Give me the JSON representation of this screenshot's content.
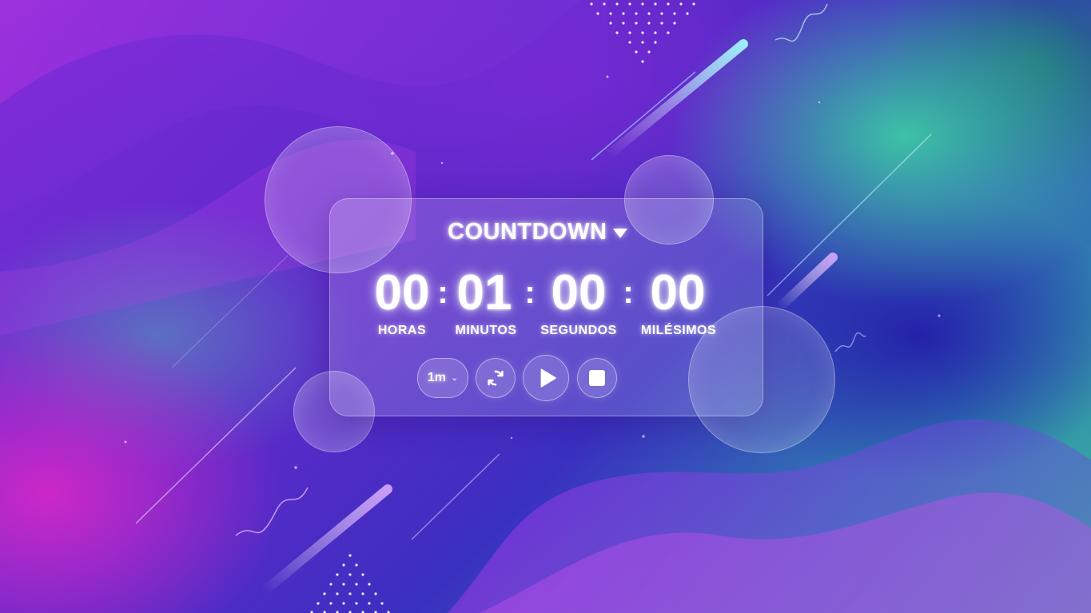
{
  "timer": {
    "mode_label": "COUNTDOWN",
    "hours": "00",
    "minutes": "01",
    "seconds": "00",
    "milliseconds": "00",
    "separator": ":",
    "hours_label": "HORAS",
    "minutes_label": "MINUTOS",
    "seconds_label": "SEGUNDOS",
    "milliseconds_label": "MILÉSIMOS"
  },
  "controls": {
    "preset_value": "1m",
    "reset_icon": "refresh-icon",
    "play_icon": "play-icon",
    "stop_icon": "stop-icon",
    "dropdown_icon": "chevron-down-icon",
    "mode_dropdown_icon": "caret-down-icon"
  },
  "colors": {
    "accent_glow": "#ffffff",
    "background_purple": "#7a2bd6",
    "background_teal": "#3bbd9a",
    "background_magenta": "#d228c8",
    "background_blue": "#231ea8"
  }
}
